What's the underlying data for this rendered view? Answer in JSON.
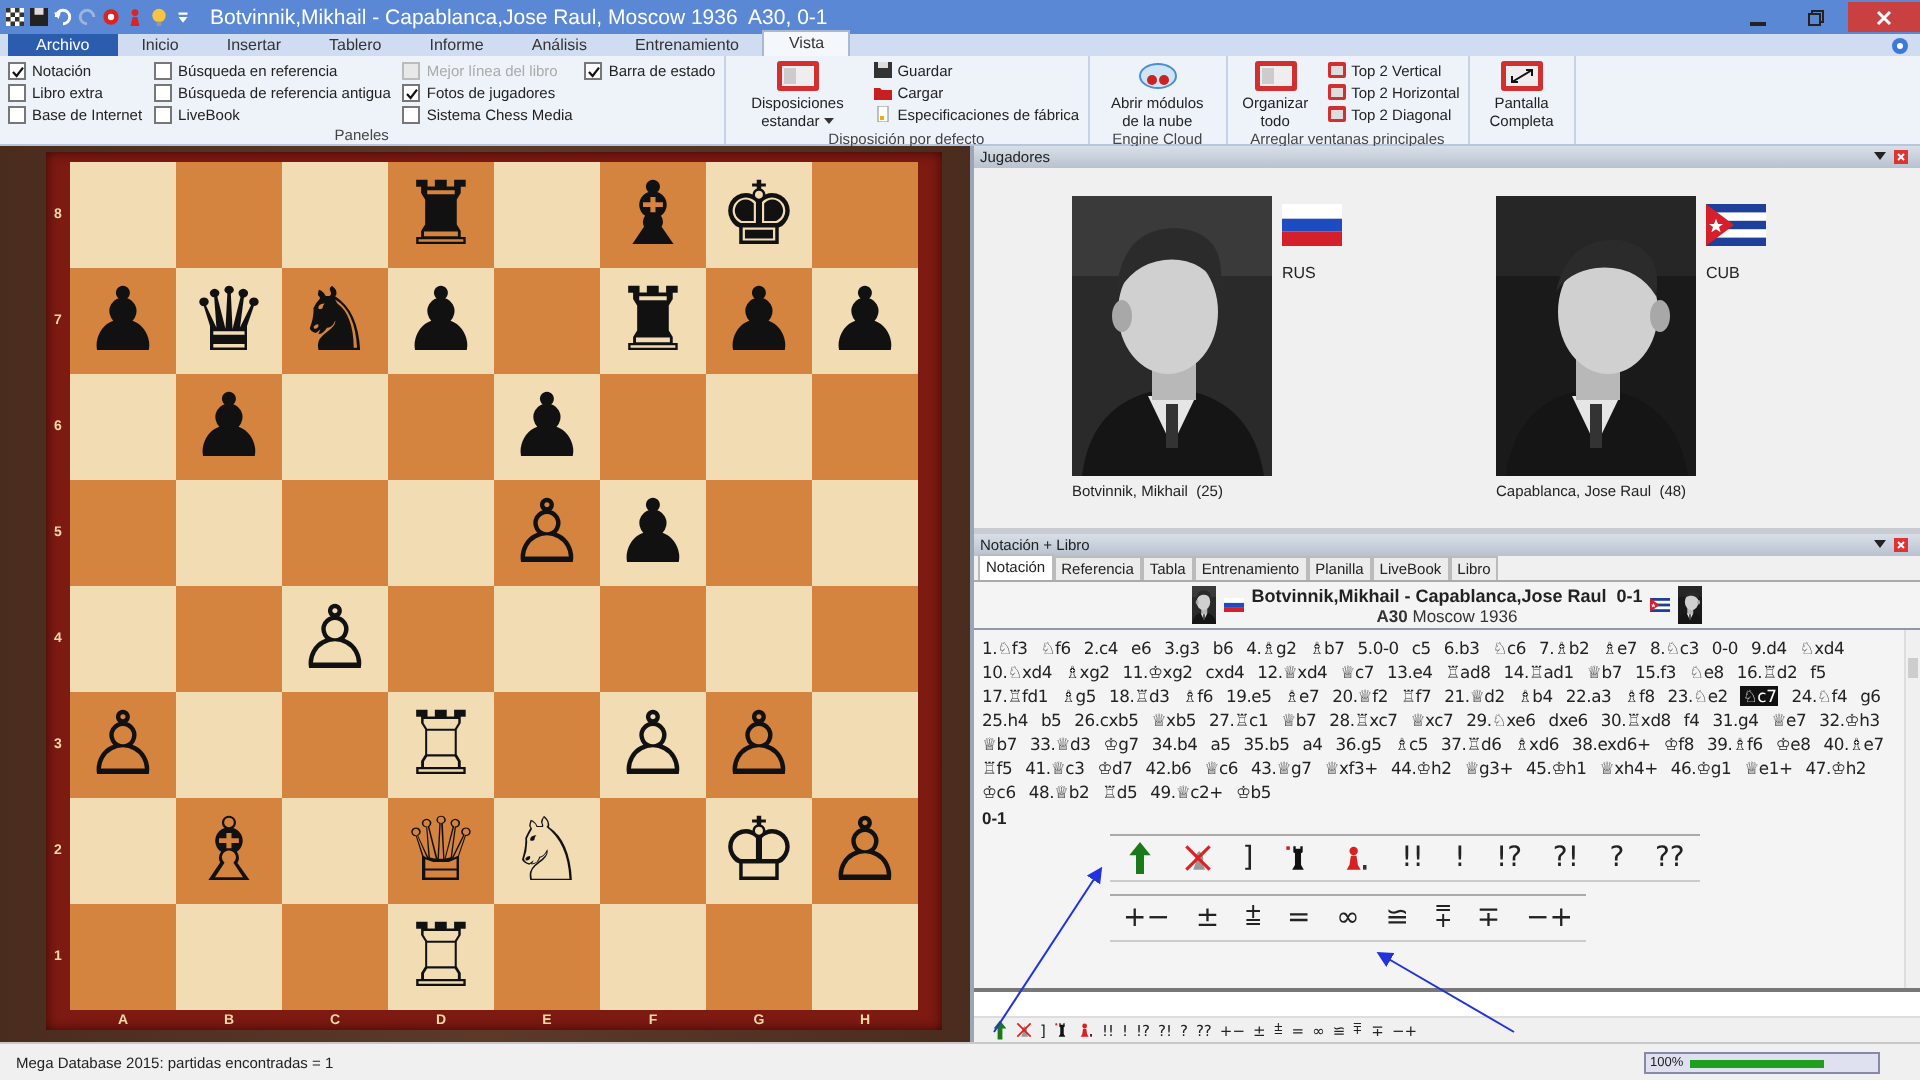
{
  "title_bar": {
    "title": "Botvinnik,Mikhail - Capablanca,Jose Raul, Moscow 1936  A30, 0-1"
  },
  "ribbon_tabs": [
    {
      "label": "Archivo",
      "kind": "file",
      "selected": false
    },
    {
      "label": "Inicio",
      "kind": "tab",
      "selected": false
    },
    {
      "label": "Insertar",
      "kind": "tab",
      "selected": false
    },
    {
      "label": "Tablero",
      "kind": "tab",
      "selected": false
    },
    {
      "label": "Informe",
      "kind": "tab",
      "selected": false
    },
    {
      "label": "Análisis",
      "kind": "tab",
      "selected": false
    },
    {
      "label": "Entrenamiento",
      "kind": "tab",
      "selected": false
    },
    {
      "label": "Vista",
      "kind": "tab",
      "selected": true
    }
  ],
  "panels_group": {
    "label": "Paneles",
    "options": [
      {
        "label": "Notación",
        "checked": true,
        "disabled": false
      },
      {
        "label": "Libro extra",
        "checked": false,
        "disabled": false
      },
      {
        "label": "Base de Internet",
        "checked": false,
        "disabled": false
      },
      {
        "label": "Búsqueda en referencia",
        "checked": false,
        "disabled": false
      },
      {
        "label": "Búsqueda de referencia antigua",
        "checked": false,
        "disabled": false
      },
      {
        "label": "LiveBook",
        "checked": false,
        "disabled": false
      },
      {
        "label": "Mejor línea del libro",
        "checked": false,
        "disabled": true
      },
      {
        "label": "Fotos de jugadores",
        "checked": true,
        "disabled": false
      },
      {
        "label": "Sistema Chess Media",
        "checked": false,
        "disabled": false
      },
      {
        "label": "Barra de estado",
        "checked": true,
        "disabled": false
      }
    ]
  },
  "layout_group": {
    "label": "Disposición por defecto",
    "large_button": "Disposiciones estandar",
    "small_buttons": [
      {
        "label": "Guardar",
        "kind": "save"
      },
      {
        "label": "Cargar",
        "kind": "load"
      },
      {
        "label": "Especificaciones de fábrica",
        "kind": "reset"
      }
    ]
  },
  "cloud_group": {
    "label": "Engine Cloud",
    "button": "Abrir módulos de la nube"
  },
  "windows_group": {
    "label": "Arreglar ventanas principales",
    "large_button": "Organizar todo",
    "small_buttons": [
      "Top 2 Vertical",
      "Top 2 Horizontal",
      "Top 2 Diagonal"
    ]
  },
  "fullscreen_button": "Pantalla Completa",
  "board": {
    "files": [
      "A",
      "B",
      "C",
      "D",
      "E",
      "F",
      "G",
      "H"
    ],
    "ranks": [
      "8",
      "7",
      "6",
      "5",
      "4",
      "3",
      "2",
      "1"
    ],
    "rows": [
      [
        {
          "kind": "empty"
        },
        {
          "kind": "empty"
        },
        {
          "kind": "empty"
        },
        {
          "kind": "piece",
          "glyph": "♜"
        },
        {
          "kind": "empty"
        },
        {
          "kind": "piece",
          "glyph": "♝"
        },
        {
          "kind": "piece",
          "glyph": "♚"
        },
        {
          "kind": "empty"
        }
      ],
      [
        {
          "kind": "piece",
          "glyph": "♟"
        },
        {
          "kind": "piece",
          "glyph": "♛"
        },
        {
          "kind": "piece",
          "glyph": "♞"
        },
        {
          "kind": "piece",
          "glyph": "♟"
        },
        {
          "kind": "empty"
        },
        {
          "kind": "piece",
          "glyph": "♜"
        },
        {
          "kind": "piece",
          "glyph": "♟"
        },
        {
          "kind": "piece",
          "glyph": "♟"
        }
      ],
      [
        {
          "kind": "empty"
        },
        {
          "kind": "piece",
          "glyph": "♟"
        },
        {
          "kind": "empty"
        },
        {
          "kind": "empty"
        },
        {
          "kind": "piece",
          "glyph": "♟"
        },
        {
          "kind": "empty"
        },
        {
          "kind": "empty"
        },
        {
          "kind": "empty"
        }
      ],
      [
        {
          "kind": "empty"
        },
        {
          "kind": "empty"
        },
        {
          "kind": "empty"
        },
        {
          "kind": "empty"
        },
        {
          "kind": "piece",
          "glyph": "♙"
        },
        {
          "kind": "piece",
          "glyph": "♟"
        },
        {
          "kind": "empty"
        },
        {
          "kind": "empty"
        }
      ],
      [
        {
          "kind": "empty"
        },
        {
          "kind": "empty"
        },
        {
          "kind": "piece",
          "glyph": "♙"
        },
        {
          "kind": "empty"
        },
        {
          "kind": "empty"
        },
        {
          "kind": "empty"
        },
        {
          "kind": "empty"
        },
        {
          "kind": "empty"
        }
      ],
      [
        {
          "kind": "piece",
          "glyph": "♙"
        },
        {
          "kind": "empty"
        },
        {
          "kind": "empty"
        },
        {
          "kind": "piece",
          "glyph": "♖"
        },
        {
          "kind": "empty"
        },
        {
          "kind": "piece",
          "glyph": "♙"
        },
        {
          "kind": "piece",
          "glyph": "♙"
        },
        {
          "kind": "empty"
        }
      ],
      [
        {
          "kind": "empty"
        },
        {
          "kind": "piece",
          "glyph": "♗"
        },
        {
          "kind": "empty"
        },
        {
          "kind": "piece",
          "glyph": "♕"
        },
        {
          "kind": "piece",
          "glyph": "♘"
        },
        {
          "kind": "empty"
        },
        {
          "kind": "piece",
          "glyph": "♔"
        },
        {
          "kind": "piece",
          "glyph": "♙"
        }
      ],
      [
        {
          "kind": "empty"
        },
        {
          "kind": "empty"
        },
        {
          "kind": "empty"
        },
        {
          "kind": "piece",
          "glyph": "♖"
        },
        {
          "kind": "empty"
        },
        {
          "kind": "empty"
        },
        {
          "kind": "empty"
        },
        {
          "kind": "empty"
        }
      ]
    ]
  },
  "players_panel": {
    "title": "Jugadores",
    "players": [
      {
        "name": "Botvinnik, Mikhail  (25)",
        "country": "RUS",
        "flag": {
          "kind": "rus"
        }
      },
      {
        "name": "Capablanca, Jose Raul  (48)",
        "country": "CUB",
        "flag": {
          "kind": "cub"
        }
      }
    ]
  },
  "notation_panel": {
    "title": "Notación + Libro",
    "tabs": [
      {
        "label": "Notación",
        "selected": true
      },
      {
        "label": "Referencia",
        "selected": false
      },
      {
        "label": "Tabla",
        "selected": false
      },
      {
        "label": "Entrenamiento",
        "selected": false
      },
      {
        "label": "Planilla",
        "selected": false
      },
      {
        "label": "LiveBook",
        "selected": false
      },
      {
        "label": "Libro",
        "selected": false
      }
    ],
    "game_title": "Botvinnik,Mikhail - Capablanca,Jose Raul  0-1",
    "white_flag": {
      "kind": "rus"
    },
    "black_flag": {
      "kind": "cub"
    },
    "game_info": "**A30** Moscow 1936",
    "moves": [
      {
        "text": "1.♘f3",
        "selected": false
      },
      {
        "text": "♘f6",
        "selected": false
      },
      {
        "text": "2.c4",
        "selected": false
      },
      {
        "text": "e6",
        "selected": false
      },
      {
        "text": "3.g3",
        "selected": false
      },
      {
        "text": "b6",
        "selected": false
      },
      {
        "text": "4.♗g2",
        "selected": false
      },
      {
        "text": "♗b7",
        "selected": false
      },
      {
        "text": "5.0-0",
        "selected": false
      },
      {
        "text": "c5",
        "selected": false
      },
      {
        "text": "6.b3",
        "selected": false
      },
      {
        "text": "♘c6",
        "selected": false
      },
      {
        "text": "7.♗b2",
        "selected": false
      },
      {
        "text": "♗e7",
        "selected": false
      },
      {
        "text": "8.♘c3",
        "selected": false
      },
      {
        "text": "0-0",
        "selected": false
      },
      {
        "text": "9.d4",
        "selected": false
      },
      {
        "text": "♘xd4",
        "selected": false
      },
      {
        "text": "10.♘xd4",
        "selected": false
      },
      {
        "text": "♗xg2",
        "selected": false
      },
      {
        "text": "11.♔xg2",
        "selected": false
      },
      {
        "text": "cxd4",
        "selected": false
      },
      {
        "text": "12.♕xd4",
        "selected": false
      },
      {
        "text": "♕c7",
        "selected": false
      },
      {
        "text": "13.e4",
        "selected": false
      },
      {
        "text": "♖ad8",
        "selected": false
      },
      {
        "text": "14.♖ad1",
        "selected": false
      },
      {
        "text": "♕b7",
        "selected": false
      },
      {
        "text": "15.f3",
        "selected": false
      },
      {
        "text": "♘e8",
        "selected": false
      },
      {
        "text": "16.♖d2",
        "selected": false
      },
      {
        "text": "f5",
        "selected": false
      },
      {
        "text": "17.♖fd1",
        "selected": false
      },
      {
        "text": "♗g5",
        "selected": false
      },
      {
        "text": "18.♖d3",
        "selected": false
      },
      {
        "text": "♗f6",
        "selected": false
      },
      {
        "text": "19.e5",
        "selected": false
      },
      {
        "text": "♗e7",
        "selected": false
      },
      {
        "text": "20.♕f2",
        "selected": false
      },
      {
        "text": "♖f7",
        "selected": false
      },
      {
        "text": "21.♕d2",
        "selected": false
      },
      {
        "text": "♗b4",
        "selected": false
      },
      {
        "text": "22.a3",
        "selected": false
      },
      {
        "text": "♗f8",
        "selected": false
      },
      {
        "text": "23.♘e2",
        "selected": false
      },
      {
        "text": "♘c7",
        "selected": true
      },
      {
        "text": "24.♘f4",
        "selected": false
      },
      {
        "text": "g6",
        "selected": false
      },
      {
        "text": "25.h4",
        "selected": false
      },
      {
        "text": "b5",
        "selected": false
      },
      {
        "text": "26.cxb5",
        "selected": false
      },
      {
        "text": "♕xb5",
        "selected": false
      },
      {
        "text": "27.♖c1",
        "selected": false
      },
      {
        "text": "♕b7",
        "selected": false
      },
      {
        "text": "28.♖xc7",
        "selected": false
      },
      {
        "text": "♕xc7",
        "selected": false
      },
      {
        "text": "29.♘xe6",
        "selected": false
      },
      {
        "text": "dxe6",
        "selected": false
      },
      {
        "text": "30.♖xd8",
        "selected": false
      },
      {
        "text": "f4",
        "selected": false
      },
      {
        "text": "31.g4",
        "selected": false
      },
      {
        "text": "♕e7",
        "selected": false
      },
      {
        "text": "32.♔h3",
        "selected": false
      },
      {
        "text": "♕b7",
        "selected": false
      },
      {
        "text": "33.♕d3",
        "selected": false
      },
      {
        "text": "♔g7",
        "selected": false
      },
      {
        "text": "34.b4",
        "selected": false
      },
      {
        "text": "a5",
        "selected": false
      },
      {
        "text": "35.b5",
        "selected": false
      },
      {
        "text": "a4",
        "selected": false
      },
      {
        "text": "36.g5",
        "selected": false
      },
      {
        "text": "♗c5",
        "selected": false
      },
      {
        "text": "37.♖d6",
        "selected": false
      },
      {
        "text": "♗xd6",
        "selected": false
      },
      {
        "text": "38.exd6+",
        "selected": false
      },
      {
        "text": "♔f8",
        "selected": false
      },
      {
        "text": "39.♗f6",
        "selected": false
      },
      {
        "text": "♔e8",
        "selected": false
      },
      {
        "text": "40.♗e7",
        "selected": false
      },
      {
        "text": "♖f5",
        "selected": false
      },
      {
        "text": "41.♕c3",
        "selected": false
      },
      {
        "text": "♔d7",
        "selected": false
      },
      {
        "text": "42.b6",
        "selected": false
      },
      {
        "text": "♕c6",
        "selected": false
      },
      {
        "text": "43.♕g7",
        "selected": false
      },
      {
        "text": "♕xf3+",
        "selected": false
      },
      {
        "text": "44.♔h2",
        "selected": false
      },
      {
        "text": "♕g3+",
        "selected": false
      },
      {
        "text": "45.♔h1",
        "selected": false
      },
      {
        "text": "♕xh4+",
        "selected": false
      },
      {
        "text": "46.♔g1",
        "selected": false
      },
      {
        "text": "♕e1+",
        "selected": false
      },
      {
        "text": "47.♔h2",
        "selected": false
      },
      {
        "text": "♔c6",
        "selected": false
      },
      {
        "text": "48.♕b2",
        "selected": false
      },
      {
        "text": "♖d5",
        "selected": false
      },
      {
        "text": "49.♕c2+",
        "selected": false
      },
      {
        "text": "♔b5",
        "selected": false
      }
    ],
    "result": "0-1",
    "palette_rows": [
      [
        {
          "kind": "arrow"
        },
        {
          "kind": "cross"
        },
        {
          "kind": "symbol",
          "text": "]"
        },
        {
          "kind": "black-piece"
        },
        {
          "kind": "red-piece"
        },
        {
          "kind": "symbol",
          "text": "!!"
        },
        {
          "kind": "symbol",
          "text": "!"
        },
        {
          "kind": "symbol",
          "text": "!?"
        },
        {
          "kind": "symbol",
          "text": "?!"
        },
        {
          "kind": "symbol",
          "text": "?"
        },
        {
          "kind": "symbol",
          "text": "??"
        }
      ],
      [
        {
          "kind": "symbol",
          "text": "+−"
        },
        {
          "kind": "symbol",
          "text": "±"
        },
        {
          "kind": "symbol",
          "text": "⩲"
        },
        {
          "kind": "symbol",
          "text": "="
        },
        {
          "kind": "symbol",
          "text": "∞"
        },
        {
          "kind": "symbol",
          "text": "≌"
        },
        {
          "kind": "symbol",
          "text": "⩱"
        },
        {
          "kind": "symbol",
          "text": "∓"
        },
        {
          "kind": "symbol",
          "text": "−+"
        }
      ]
    ],
    "toolbar": [
      {
        "kind": "arrow"
      },
      {
        "kind": "cross"
      },
      {
        "kind": "symbol",
        "text": "]"
      },
      {
        "kind": "black-piece"
      },
      {
        "kind": "red-piece"
      },
      {
        "kind": "symbol",
        "text": "!!"
      },
      {
        "kind": "symbol",
        "text": "!"
      },
      {
        "kind": "symbol",
        "text": "!?"
      },
      {
        "kind": "symbol",
        "text": "?!"
      },
      {
        "kind": "symbol",
        "text": "?"
      },
      {
        "kind": "symbol",
        "text": "??"
      },
      {
        "kind": "symbol",
        "text": "+−"
      },
      {
        "kind": "symbol",
        "text": "±"
      },
      {
        "kind": "symbol",
        "text": "⩲"
      },
      {
        "kind": "symbol",
        "text": "="
      },
      {
        "kind": "symbol",
        "text": "∞"
      },
      {
        "kind": "symbol",
        "text": "≌"
      },
      {
        "kind": "symbol",
        "text": "⩱"
      },
      {
        "kind": "symbol",
        "text": "∓"
      },
      {
        "kind": "symbol",
        "text": "−+"
      }
    ]
  },
  "status_bar": {
    "text": "Mega Database 2015: partidas encontradas = 1",
    "progress_label": "100%",
    "level": 0.73
  }
}
